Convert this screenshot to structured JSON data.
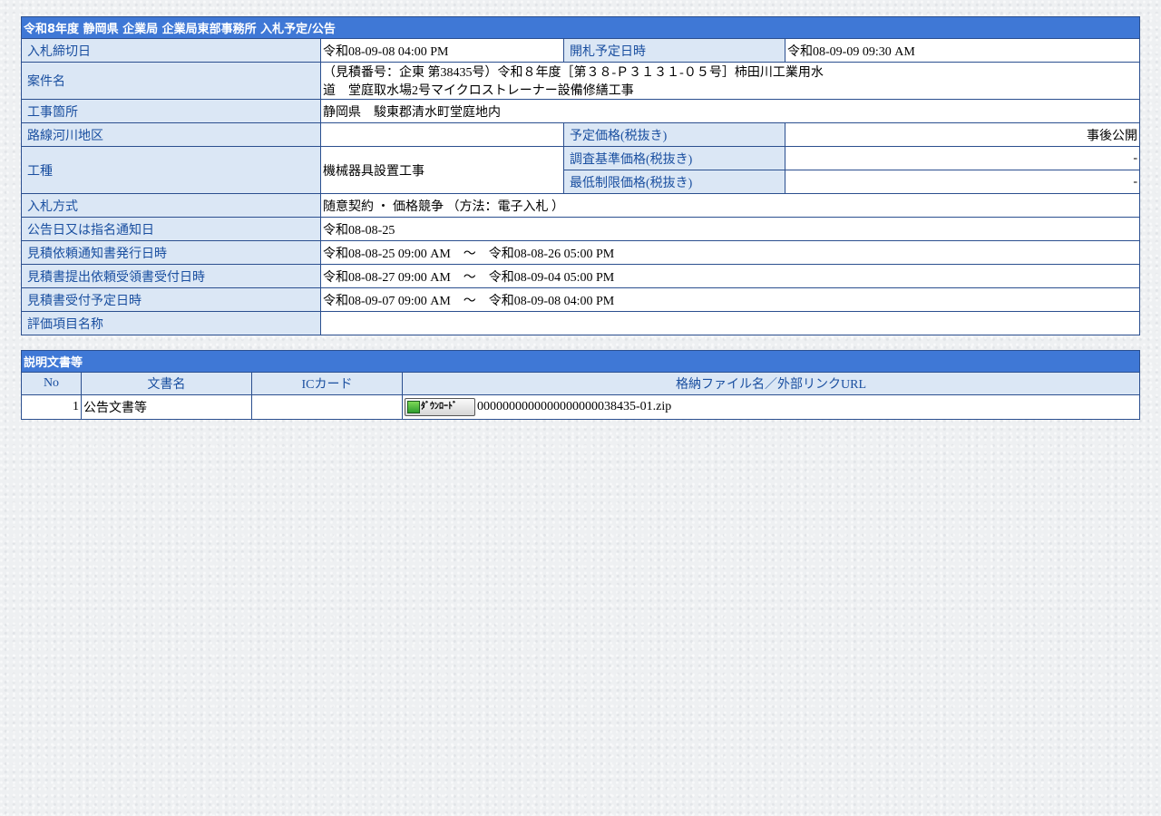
{
  "detail": {
    "header": "令和8年度 静岡県 企業局 企業局東部事務所 入札予定/公告",
    "rows": {
      "deadline": {
        "label": "入札締切日",
        "value": "令和08-09-08 04:00 PM"
      },
      "opening": {
        "label": "開札予定日時",
        "value": "令和08-09-09 09:30 AM"
      },
      "project_name": {
        "label": "案件名",
        "line1": "（見積番号：企東 第38435号）令和８年度［第３８-Ｐ３１３１-０５号］柿田川工業用水",
        "line2": "道　堂庭取水場2号マイクロストレーナー設備修繕工事"
      },
      "location": {
        "label": "工事箇所",
        "value": "静岡県　駿東郡清水町堂庭地内"
      },
      "route": {
        "label": "路線河川地区",
        "value": ""
      },
      "planned_price": {
        "label": "予定価格(税抜き)",
        "value": "事後公開"
      },
      "work_type": {
        "label": "工種",
        "value": "機械器具設置工事"
      },
      "survey_price": {
        "label": "調査基準価格(税抜き)",
        "value": "-"
      },
      "min_price": {
        "label": "最低制限価格(税抜き)",
        "value": "-"
      },
      "method": {
        "label": "入札方式",
        "value": "随意契約 ・ 価格競争 （方法：電子入札 ）"
      },
      "notice_date": {
        "label": "公告日又は指名通知日",
        "value": "令和08-08-25"
      },
      "quote_notice": {
        "label": "見積依頼通知書発行日時",
        "value": "令和08-08-25 09:00 AM　～　令和08-08-26 05:00 PM"
      },
      "quote_receipt": {
        "label": "見積書提出依頼受領書受付日時",
        "value": "令和08-08-27 09:00 AM　～　令和08-09-04 05:00 PM"
      },
      "quote_accept": {
        "label": "見積書受付予定日時",
        "value": "令和08-09-07 09:00 AM　～　令和08-09-08 04:00 PM"
      },
      "evaluation": {
        "label": "評価項目名称",
        "value": ""
      }
    }
  },
  "documents": {
    "header": "説明文書等",
    "columns": [
      "No",
      "文書名",
      "ICカード",
      "格納ファイル名／外部リンクURL"
    ],
    "rows": [
      {
        "no": "1",
        "name": "公告文書等",
        "ic": "",
        "button_label": "ﾀﾞｳﾝﾛｰﾄﾞ",
        "filename": "0000000000000000000038435-01.zip"
      }
    ]
  }
}
